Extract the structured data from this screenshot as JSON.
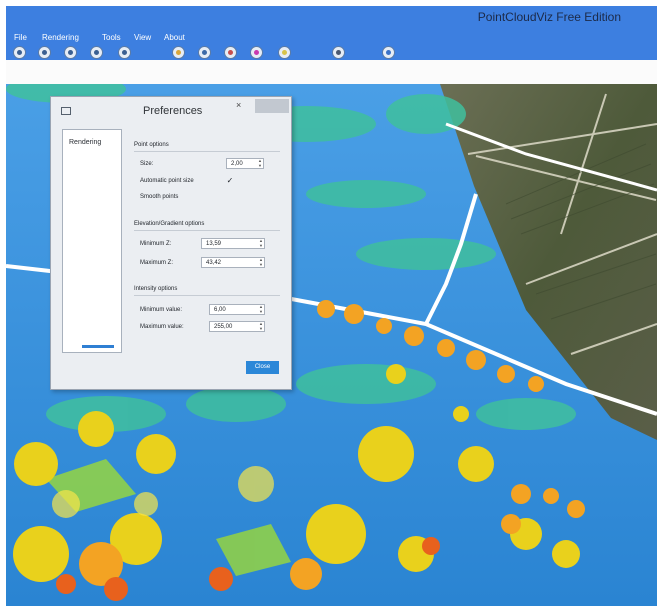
{
  "app": {
    "title": "PointCloudViz Free Edition"
  },
  "menu": [
    "File",
    "Rendering",
    "Tools",
    "View",
    "About"
  ],
  "toolbar_icons": [
    "zoom-icon",
    "camera-icon",
    "rotate-icon",
    "grid-icon",
    "split-icon",
    "layers-icon",
    "palette-icon",
    "audio-icon",
    "color-icon",
    "brush-icon",
    "settings-icon",
    "help-icon"
  ],
  "preferences": {
    "title": "Preferences",
    "close_glyph": "×",
    "side_items": [
      "Rendering"
    ],
    "point_options": {
      "heading": "Point options",
      "size_label": "Size:",
      "size_value": "2,00",
      "auto_label": "Automatic point size",
      "auto_checked": "✓",
      "smooth_label": "Smooth points"
    },
    "gradient_options": {
      "heading": "Elevation/Gradient options",
      "min_label": "Minimum Z:",
      "min_value": "13,59",
      "max_label": "Maximum Z:",
      "max_value": "43,42"
    },
    "intensity_options": {
      "heading": "Intensity options",
      "min_label": "Minimum value:",
      "min_value": "6,00",
      "max_label": "Maximum value:",
      "max_value": "255,00"
    },
    "close_label": "Close"
  },
  "colors": {
    "accent": "#3d7fe0",
    "cloud_low": "#2f8fd6",
    "cloud_mid": "#3ec9a2",
    "cloud_high": "#f2cf1e",
    "cloud_top": "#ec6b1b"
  }
}
